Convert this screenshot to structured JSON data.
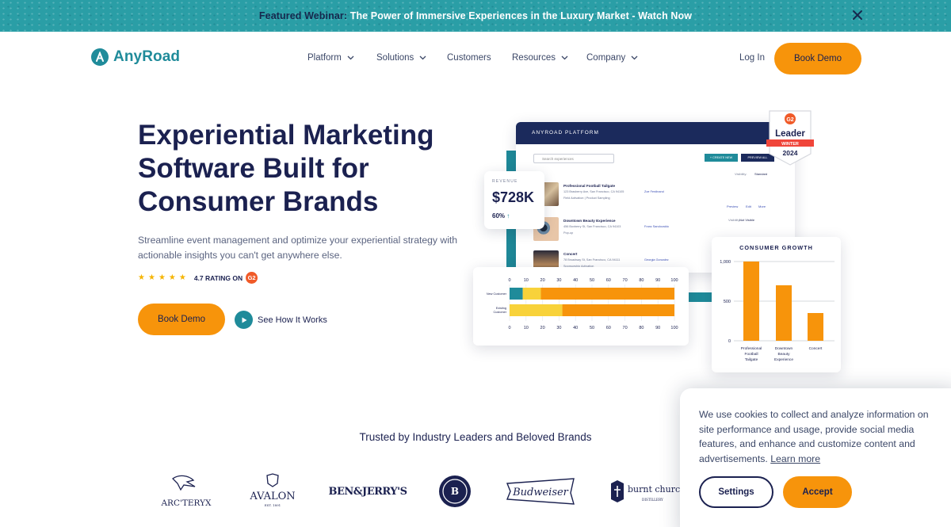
{
  "banner": {
    "prefix": "Featured Webinar:",
    "text": " The Power of Immersive Experiences in the Luxury Market - Watch Now",
    "close_icon": "close-icon"
  },
  "nav": {
    "logo_text": "AnyRoad",
    "items": [
      {
        "label": "Platform",
        "has_dropdown": true
      },
      {
        "label": "Solutions",
        "has_dropdown": true
      },
      {
        "label": "Customers",
        "has_dropdown": false
      },
      {
        "label": "Resources",
        "has_dropdown": true
      },
      {
        "label": "Company",
        "has_dropdown": true
      }
    ],
    "login": "Log In",
    "book_demo": "Book Demo"
  },
  "hero": {
    "title": "Experiential Marketing Software Built for Consumer Brands",
    "subtitle": "Streamline event management and optimize your experiential strategy with actionable insights you can't get anywhere else.",
    "rating_stars": 5,
    "rating_text": "4.7 RATING ON",
    "rating_source_icon": "g2-icon",
    "book_demo": "Book Demo",
    "see_how": "See How It Works"
  },
  "dashboard": {
    "platform_title": "ANYROAD PLATFORM",
    "search_placeholder": "Search experiences",
    "create_button": "+ CREATE NEW",
    "preview_button": "PREVIEW ALL",
    "visibility_label": "Visibility:",
    "visibility_value": "Standard",
    "events": [
      {
        "title": "Professional Football Tailgate",
        "address": "123 Brasberry Ave, San Francisco, CA 94105",
        "tag": "Field Activation | Product Sampling",
        "person": "Zoe Ferdinand"
      },
      {
        "title": "Downtown Beauty Experience",
        "address": "456 Boxberry St, San Francisco, CA 94103",
        "tag": "Pop-up",
        "person": "Franc Sandovaldo"
      },
      {
        "title": "Concert",
        "address": "78 Broadway St, San Francisco, CA 94111",
        "tag": "Sponsorship Activation",
        "person": "Georgia Gonzalez"
      }
    ],
    "row_actions": [
      "Preview",
      "Edit",
      "More"
    ],
    "visibility_value_2": "Not Visible",
    "badge": {
      "brand": "G2",
      "title": "Leader",
      "season": "WINTER",
      "year": "2024"
    },
    "revenue": {
      "label": "REVENUE",
      "value": "$728K",
      "change": "60%"
    },
    "growth_title": "CONSUMER GROWTH"
  },
  "trusted": {
    "heading": "Trusted by Industry Leaders and Beloved Brands",
    "logos": [
      "ARC'TERYX",
      "AVALON",
      "BEN&JERRY'S",
      "BROOKLYN BREWERY",
      "Budweiser",
      "burnt church"
    ]
  },
  "cookie": {
    "text": "We use cookies to collect and analyze information on site performance and usage, provide social media features, and enhance and customize content and advertisements. ",
    "learn_more": "Learn more",
    "settings": "Settings",
    "accept": "Accept"
  },
  "colors": {
    "accent_orange": "#f7940b",
    "brand_teal": "#1f8b9a",
    "navy": "#1b2150",
    "bar_yellow": "#f8d23a"
  },
  "chart_data": [
    {
      "type": "bar",
      "orientation": "horizontal",
      "stacked": true,
      "categories": [
        "New Customer",
        "Existing Customer"
      ],
      "series": [
        {
          "values": [
            8,
            0
          ],
          "color": "#1f8b9a"
        },
        {
          "values": [
            11,
            32
          ],
          "color": "#f8d23a"
        },
        {
          "values": [
            81,
            68
          ],
          "color": "#f7940b"
        }
      ],
      "x_ticks": [
        0,
        10,
        20,
        30,
        40,
        50,
        60,
        70,
        80,
        90,
        100
      ],
      "xlim": [
        0,
        100
      ]
    },
    {
      "type": "bar",
      "title": "CONSUMER GROWTH",
      "categories": [
        "Professional Football Tailgate",
        "Downtown Beauty Experience",
        "Concert"
      ],
      "values": [
        1000,
        700,
        350
      ],
      "y_ticks": [
        "0",
        "500",
        "1,000"
      ],
      "ylim": [
        0,
        1000
      ]
    }
  ]
}
